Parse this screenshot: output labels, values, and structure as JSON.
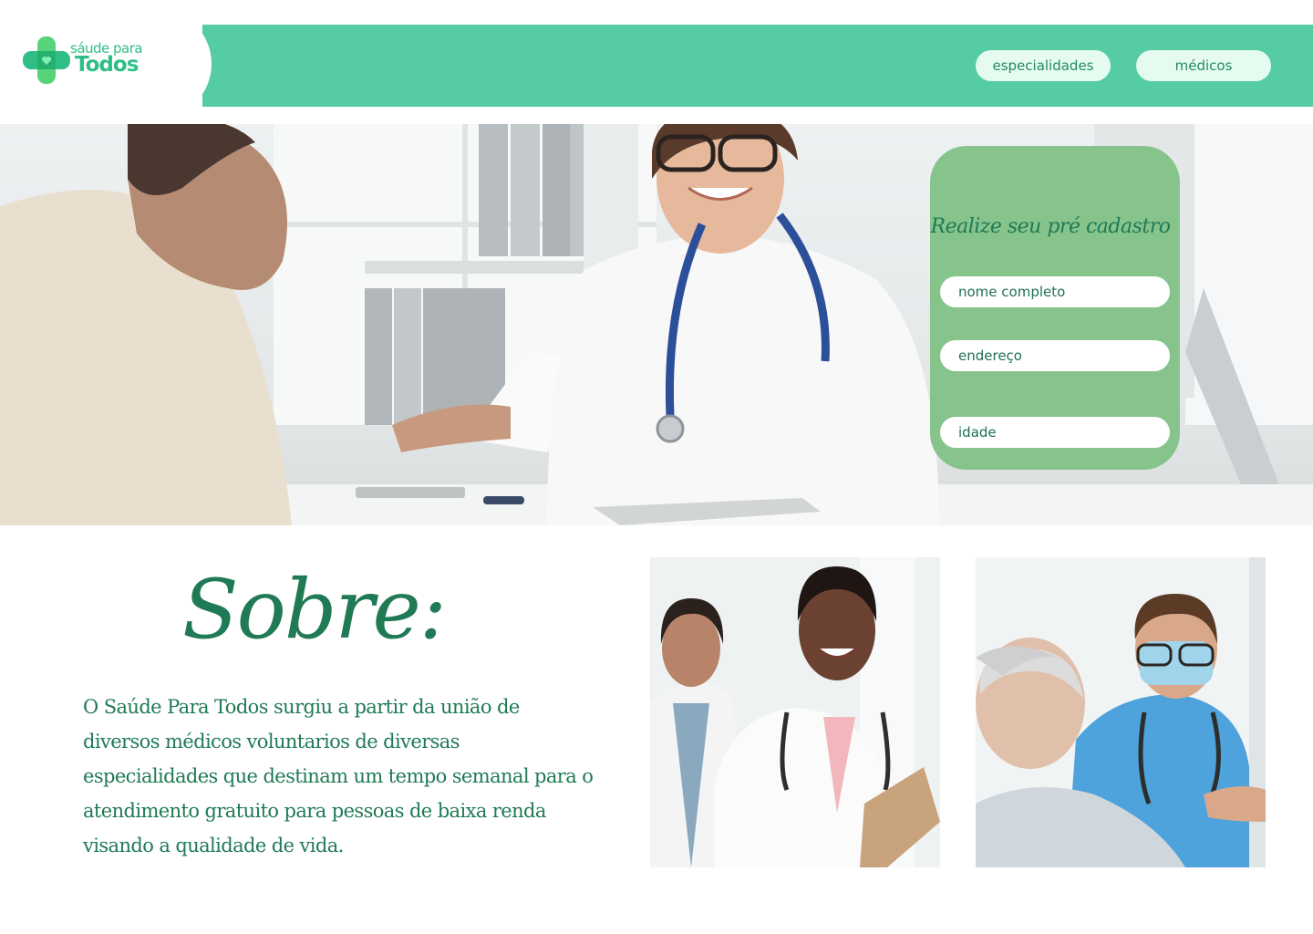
{
  "brand": {
    "name_small": "sáude para",
    "name_big": "Todos",
    "color_primary": "#55cca3",
    "color_logo": "#2fbf86"
  },
  "nav": {
    "items": [
      {
        "label": "especialidades"
      },
      {
        "label": "médicos"
      }
    ]
  },
  "hero": {
    "form": {
      "title": "Realize seu pré cadastro",
      "fields": [
        {
          "placeholder": "nome completo"
        },
        {
          "placeholder": "endereço"
        },
        {
          "placeholder": "idade"
        }
      ],
      "card_color": "#86c48c"
    }
  },
  "about": {
    "title": "Sobre:",
    "text": "O Saúde Para Todos surgiu a partir da união de diversos médicos voluntarios de diversas especialidades que destinam um tempo semanal para o atendimento gratuito para pessoas de baixa renda visando a qualidade de vida.",
    "text_color": "#1f7a55"
  }
}
